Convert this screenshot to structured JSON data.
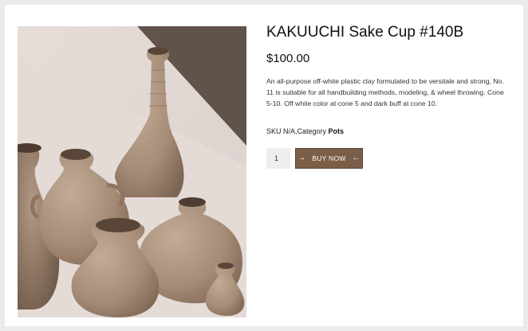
{
  "product": {
    "title": "KAKUUCHI Sake Cup #140B",
    "price": "$100.00",
    "description": "An all-purpose off-white plastic clay formulated to be versitale and strong, No. 11 is suitable for all handbuilding methods, modeling, & wheel throwing. Cone 5-10. Off white color at cone 5 and dark buff at cone 10.",
    "sku_text": "SKU N/A,Category ",
    "category": "Pots",
    "quantity": "1",
    "buy_label": "BUY NOW",
    "arrow_right": "→",
    "arrow_left": "←"
  },
  "colors": {
    "button": "#7b5e47",
    "clay": "#a88f79",
    "background": "#ebebeb"
  }
}
